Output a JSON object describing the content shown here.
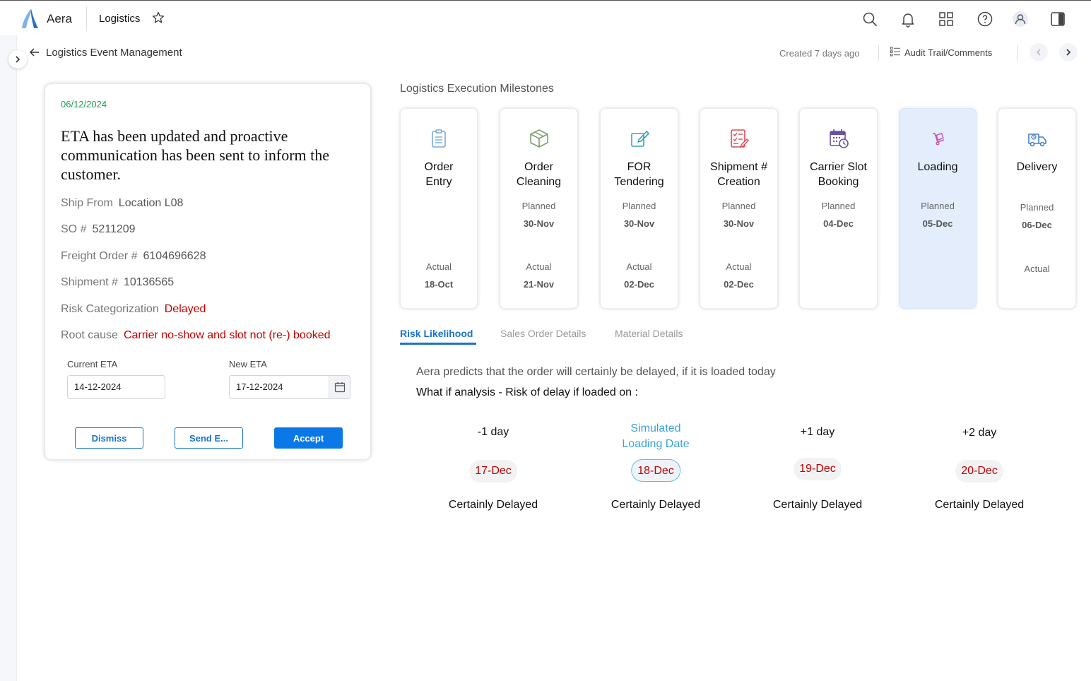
{
  "header": {
    "brand": "Aera",
    "app_title": "Logistics"
  },
  "subheader": {
    "page_title": "Logistics Event Management",
    "created": "Created 7 days ago",
    "audit": "Audit Trail/Comments"
  },
  "event": {
    "date": "06/12/2024",
    "headline": "ETA has been updated and proactive communication has been sent to inform the customer.",
    "fields": [
      {
        "label": "Ship From",
        "value": "Location L08"
      },
      {
        "label": "SO #",
        "value": "5211209"
      },
      {
        "label": "Freight Order #",
        "value": "6104696628"
      },
      {
        "label": "Shipment #",
        "value": "10136565"
      },
      {
        "label": "Risk Categorization",
        "value": "Delayed"
      },
      {
        "label": "Root cause",
        "value": "Carrier no-show and slot not (re-) booked"
      }
    ],
    "current_eta_label": "Current ETA",
    "current_eta": "14-12-2024",
    "new_eta_label": "New ETA",
    "new_eta": "17-12-2024",
    "buttons": {
      "dismiss": "Dismiss",
      "send": "Send E...",
      "accept": "Accept"
    }
  },
  "milestones": {
    "heading": "Logistics Execution Milestones",
    "planned_label": "Planned",
    "actual_label": "Actual",
    "items": [
      {
        "line1": "Order",
        "line2": "Entry",
        "planned": "",
        "actual": "18-Oct",
        "icon": "clipboard-icon"
      },
      {
        "line1": "Order",
        "line2": "Cleaning",
        "planned": "30-Nov",
        "actual": "21-Nov",
        "icon": "box-icon"
      },
      {
        "line1": "FOR",
        "line2": "Tendering",
        "planned": "30-Nov",
        "actual": "02-Dec",
        "icon": "edit-icon"
      },
      {
        "line1": "Shipment #",
        "line2": "Creation",
        "planned": "30-Nov",
        "actual": "02-Dec",
        "icon": "checklist-icon"
      },
      {
        "line1": "Carrier Slot",
        "line2": "Booking",
        "planned": "04-Dec",
        "actual": "",
        "icon": "calendar-clock-icon"
      },
      {
        "line1": "Loading",
        "line2": "",
        "planned": "05-Dec",
        "actual": "",
        "icon": "hand-truck-icon"
      },
      {
        "line1": "Delivery",
        "line2": "",
        "planned": "06-Dec",
        "actual": "",
        "icon": "delivery-truck-icon"
      }
    ]
  },
  "tabs": [
    "Risk Likelihood",
    "Sales Order Details",
    "Material Details"
  ],
  "prediction": {
    "line1": "Aera predicts that the order will certainly be delayed, if it is loaded today",
    "line2": "What if analysis - Risk of delay if loaded on :",
    "options": [
      {
        "label": "-1 day",
        "label2": "",
        "date": "17-Dec",
        "status": "Certainly Delayed"
      },
      {
        "label": "Simulated",
        "label2": "Loading Date",
        "date": "18-Dec",
        "status": "Certainly Delayed"
      },
      {
        "label": "+1 day",
        "label2": "",
        "date": "19-Dec",
        "status": "Certainly Delayed"
      },
      {
        "label": "+2 day",
        "label2": "",
        "date": "20-Dec",
        "status": "Certainly Delayed"
      }
    ]
  },
  "colors": {
    "accent": "#1a73c9",
    "delayed": "#c00000",
    "date_green": "#1e9c57",
    "active_milestone": "#e3edfc"
  }
}
